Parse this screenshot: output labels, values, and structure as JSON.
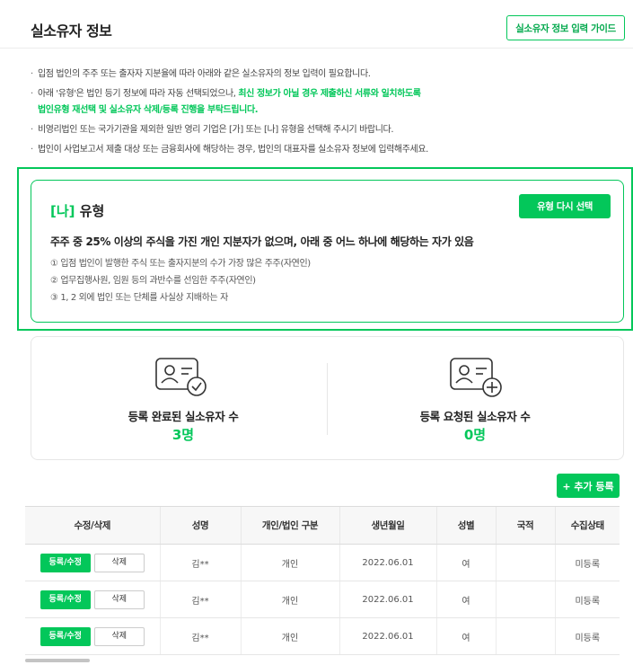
{
  "header": {
    "title": "실소유자 정보",
    "guide_button": "실소유자 정보 입력 가이드"
  },
  "notices": {
    "n1": "입점 법인의 주주 또는 출자자 지분율에 따라 아래와 같은 실소유자의 정보 입력이 필요합니다.",
    "n2_prefix": "아래 '유형'은 법인 등기 정보에 따라 자동 선택되었으나, ",
    "n2_highlight_a": "최신 정보가 아닐 경우 제출하신 서류와 일치하도록",
    "n2_highlight_b": "법인유형 재선택 및 실소유자 삭제/등록 진행을 부탁드립니다.",
    "n3": "비영리법인 또는 국가기관을 제외한 일반 영리 기업은 [가] 또는 [나] 유형을 선택해 주시기 바랍니다.",
    "n4": "법인이 사업보고서 제출 대상 또는 금융회사에 해당하는 경우, 법인의 대표자를 실소유자 정보에 입력해주세요."
  },
  "type_box": {
    "tag": "[나]",
    "title": " 유형",
    "reselect_button": "유형 다시 선택",
    "description": "주주 중 25% 이상의 주식을 가진 개인 지분자가 없으며, 아래 중 어느 하나에 해당하는 자가 있음",
    "items": [
      "① 입점 법인이 발행한 주식 또는 출자지분의 수가 가장 많은 주주(자연인)",
      "② 업무집행사원, 임원 등의 과반수를 선임한 주주(자연인)",
      "③ 1, 2 외에 법인 또는 단체를 사실상 지배하는 자"
    ]
  },
  "stats": {
    "completed_label": "등록 완료된 실소유자 수",
    "completed_value": "3명",
    "requested_label": "등록 요청된 실소유자 수",
    "requested_value": "0명"
  },
  "add_button": "+ 추가 등록",
  "table": {
    "headers": [
      "수정/삭제",
      "성명",
      "개인/법인 구분",
      "생년월일",
      "성별",
      "국적",
      "수집상태"
    ],
    "edit_label": "등록/수정",
    "delete_label": "삭제",
    "rows": [
      {
        "name": "김**",
        "type": "개인",
        "birth": "2022.06.01",
        "gender": "여",
        "nationality": "",
        "status": "미등록"
      },
      {
        "name": "김**",
        "type": "개인",
        "birth": "2022.06.01",
        "gender": "여",
        "nationality": "",
        "status": "미등록"
      },
      {
        "name": "김**",
        "type": "개인",
        "birth": "2022.06.01",
        "gender": "여",
        "nationality": "",
        "status": "미등록"
      }
    ]
  },
  "colors": {
    "accent": "#03c75a",
    "status_unregistered": "#f0505a"
  },
  "icons": {
    "completed": "id-card-check-icon",
    "requested": "id-card-plus-icon"
  }
}
